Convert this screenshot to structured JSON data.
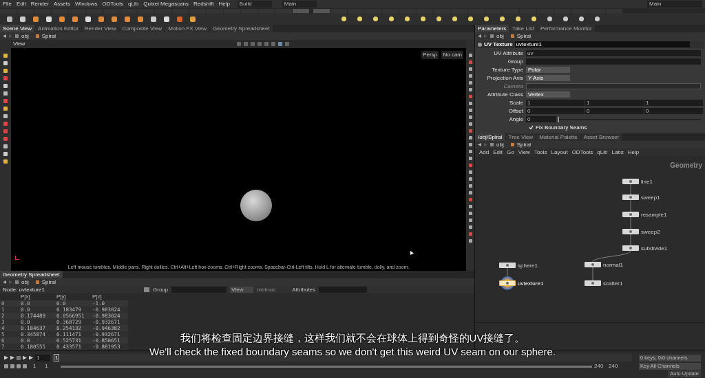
{
  "menu_bar": {
    "items": [
      "File",
      "Edit",
      "Render",
      "Assets",
      "Windows",
      "ODTools",
      "qLib",
      "Quixel Megascans",
      "Redshift",
      "Help"
    ],
    "desktop": "Build",
    "workspaces": [
      "Main",
      "Main"
    ]
  },
  "left_pane_tabs": [
    {
      "label": "Scene View",
      "selected": true
    },
    {
      "label": "Animation Editor",
      "selected": false
    },
    {
      "label": "Render View",
      "selected": false
    },
    {
      "label": "Composite View",
      "selected": false
    },
    {
      "label": "Motion FX View",
      "selected": false
    },
    {
      "label": "Geometry Spreadsheet",
      "selected": false
    }
  ],
  "scene_path": [
    "obj",
    "Spiral"
  ],
  "viewport": {
    "title": "View",
    "camera_menu": "Persp",
    "cam_menu": "No cam",
    "status": "Left mouse tumbles. Middle pans. Right dollies. Ctrl+Alt+Left box-zooms. Ctrl+Right zooms. Spacebar-Ctrl-Left tilts. Hold L for alternate tumble, dolly, and zoom."
  },
  "spreadsheet": {
    "tab": "Geometry Spreadsheet",
    "path": [
      "obj",
      "Spiral"
    ],
    "node_label": "Node:",
    "node": "uvtexture1",
    "group_label": "Group",
    "view": "View",
    "intrinsic": "Intrinsic",
    "attributes_label": "Attributes",
    "columns": [
      "",
      "P[x]",
      "P[y]",
      "P[z]"
    ],
    "rows": [
      [
        "0",
        "0.0",
        "0.0",
        "-1.0"
      ],
      [
        "1",
        "0.0",
        "0.183479",
        "-0.983024"
      ],
      [
        "2",
        "0.174489",
        "0.0566951",
        "-0.983024"
      ],
      [
        "3",
        "0.0",
        "0.368729",
        "-0.932671"
      ],
      [
        "4",
        "0.184637",
        "0.254132",
        "-0.946382"
      ],
      [
        "5",
        "0.345874",
        "0.111471",
        "-0.932671"
      ],
      [
        "6",
        "0.0",
        "0.525731",
        "-0.850651"
      ],
      [
        "7",
        "0.180555",
        "0.433571",
        "-0.881953"
      ]
    ]
  },
  "right_pane_tabs": [
    {
      "label": "Parameters",
      "selected": true
    },
    {
      "label": "Take List",
      "selected": false
    },
    {
      "label": "Performance Monitor",
      "selected": false
    }
  ],
  "parameters_path": [
    "obj",
    "Spiral"
  ],
  "parameters": {
    "node_type": "UV Texture",
    "node_name": "uvtexture1",
    "fields": [
      {
        "kind": "text",
        "label": "UV Attribute",
        "value": "uv",
        "disabled": false
      },
      {
        "kind": "text",
        "label": "Group",
        "disabled": false
      },
      {
        "kind": "menu",
        "label": "Texture Type",
        "value": "Polar",
        "disabled": false
      },
      {
        "kind": "menu",
        "label": "Projection Axis",
        "value": "Y Axis",
        "disabled": false
      },
      {
        "kind": "text",
        "label": "Camera",
        "disabled": true
      },
      {
        "kind": "menu",
        "label": "Attribute Class",
        "value": "Vertex",
        "disabled": false
      },
      {
        "kind": "triple",
        "label": "Scale",
        "values": [
          "1",
          "1",
          "1"
        ],
        "disabled": false
      },
      {
        "kind": "triple",
        "label": "Offset",
        "values": [
          "0",
          "0",
          "0"
        ],
        "disabled": false
      },
      {
        "kind": "slider",
        "label": "Angle",
        "value": "0",
        "level": 0,
        "disabled": false
      },
      {
        "kind": "checkbox",
        "label": "Fix Boundary Seams",
        "checked": true,
        "disabled": false
      }
    ]
  },
  "network_tabs": [
    {
      "label": "/obj/Spiral",
      "selected": true
    },
    {
      "label": "Tree View",
      "selected": false
    },
    {
      "label": "Material Palette",
      "selected": false
    },
    {
      "label": "Asset Browser",
      "selected": false
    }
  ],
  "network_path": [
    "obj",
    "Spiral"
  ],
  "network_menu": [
    "Add",
    "Edit",
    "Go",
    "View",
    "Tools",
    "Layout",
    "ODTools",
    "qLib",
    "Labs",
    "Help"
  ],
  "network": {
    "context": "Geometry",
    "nodes": [
      {
        "label": "line1",
        "display": false,
        "selected": false
      },
      {
        "label": "sweep1",
        "display": false,
        "selected": false
      },
      {
        "label": "resample1",
        "display": false,
        "selected": false
      },
      {
        "label": "sweep2",
        "display": false,
        "selected": false
      },
      {
        "label": "subdivide1",
        "display": false,
        "selected": false
      },
      {
        "label": "sphere1",
        "display": false,
        "selected": false
      },
      {
        "label": "normal1",
        "display": false,
        "selected": false
      },
      {
        "label": "uvtexture1",
        "display": true,
        "selected": true
      },
      {
        "label": "scatter1",
        "display": false,
        "selected": false
      }
    ]
  },
  "subtitles": {
    "chinese": "我们将检查固定边界接缝，这样我们就不会在球体上得到奇怪的UV接缝了。",
    "english": "We'll check the fixed boundary seams so we don't get this weird UV seam on our sphere."
  },
  "timeline": {
    "frame": "1",
    "marker_frame": "1",
    "start": "1",
    "range_start": "1",
    "range_end": "240",
    "end": "240",
    "range_bar": {
      "level": 1
    },
    "keys_menu": "0 keys, 0/0 channels",
    "key_all": "Key All Channels",
    "auto_update": "Auto Update"
  }
}
